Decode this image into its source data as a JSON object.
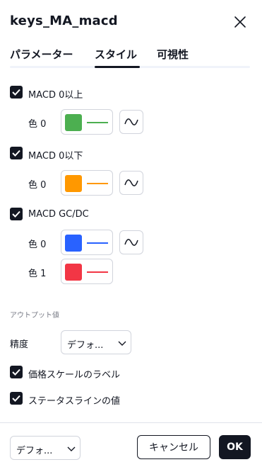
{
  "dialog": {
    "title": "keys_MA_macd",
    "close_icon": "close-icon"
  },
  "tabs": [
    {
      "label": "パラメーター",
      "active": false
    },
    {
      "label": "スタイル",
      "active": true
    },
    {
      "label": "可視性",
      "active": false
    }
  ],
  "plots": [
    {
      "label": "MACD 0以上",
      "checked": true,
      "colors": [
        {
          "label": "色 0",
          "color": "#4caf50",
          "has_style_button": true
        }
      ]
    },
    {
      "label": "MACD 0以下",
      "checked": true,
      "colors": [
        {
          "label": "色 0",
          "color": "#ff9800",
          "has_style_button": true
        }
      ]
    },
    {
      "label": "MACD GC/DC",
      "checked": true,
      "colors": [
        {
          "label": "色 0",
          "color": "#2962ff",
          "has_style_button": true
        },
        {
          "label": "色 1",
          "color": "#f23645",
          "has_style_button": false
        }
      ]
    }
  ],
  "output_values": {
    "section_title": "アウトプット値",
    "precision_label": "精度",
    "precision_value": "デフォ...",
    "scale_label": {
      "label": "価格スケールのラベル",
      "checked": true
    },
    "status_line": {
      "label": "ステータスラインの値",
      "checked": true
    }
  },
  "footer": {
    "defaults_value": "デフォ...",
    "cancel_label": "キャンセル",
    "ok_label": "OK"
  },
  "colors": {
    "text": "#131722",
    "border": "#d1d4dc",
    "muted": "#787b86"
  }
}
